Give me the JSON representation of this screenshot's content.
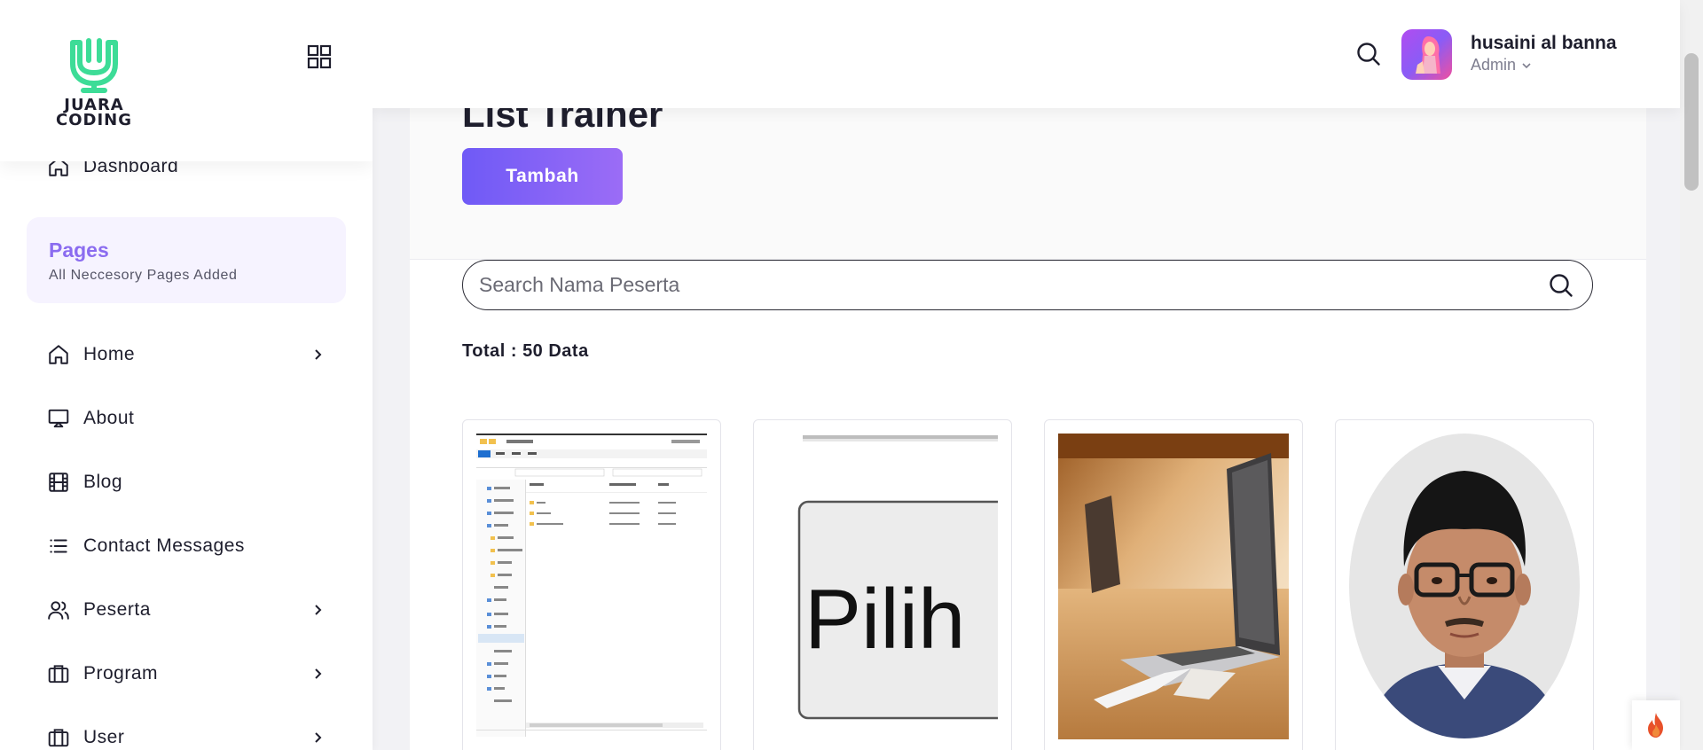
{
  "brand": {
    "logo_text_line1": "JUARA",
    "logo_text_line2": "CODING",
    "accent": "#3ddc97",
    "primary": "#7b61ff"
  },
  "sidebar": {
    "items": [
      {
        "label": "Dashboard",
        "icon": "home-icon"
      },
      {
        "label": "Home",
        "icon": "home-icon",
        "has_children": true
      },
      {
        "label": "About",
        "icon": "monitor-icon"
      },
      {
        "label": "Blog",
        "icon": "film-icon"
      },
      {
        "label": "Contact Messages",
        "icon": "list-icon"
      },
      {
        "label": "Peserta",
        "icon": "users-icon",
        "has_children": true
      },
      {
        "label": "Program",
        "icon": "briefcase-icon",
        "has_children": true
      },
      {
        "label": "User",
        "icon": "briefcase-icon",
        "has_children": true
      }
    ],
    "section": {
      "title": "Pages",
      "subtitle": "All Neccesory Pages Added"
    }
  },
  "header": {
    "user_name": "husaini al banna",
    "user_role": "Admin"
  },
  "main": {
    "title": "List Trainer",
    "add_button": "Tambah",
    "search_placeholder": "Search Nama Peserta",
    "total_text": "Total : 50 Data",
    "trainer_cards": [
      {
        "image": "file-explorer-screenshot"
      },
      {
        "image": "pilih-button-image"
      },
      {
        "image": "laptop-photo"
      },
      {
        "image": "man-with-glasses-portrait"
      }
    ],
    "pilih_text": "Pilih"
  }
}
